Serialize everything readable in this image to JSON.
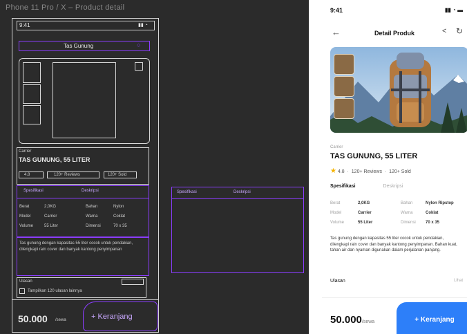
{
  "canvas": {
    "frame_title": "Phone 11 Pro / X – Product detail",
    "wireframe": {
      "status_time": "9:41",
      "search_text": "Tas Gunung",
      "info_tag": "Carrier",
      "product_title": "TAS GUNUNG, 55 LITER",
      "chips": [
        "4.8",
        "120+ Reviews",
        "120+ Sold"
      ],
      "table_headers": [
        "Spesifikasi",
        "Deskripsi"
      ],
      "side_headers": [
        "Spesifikasi",
        "Deskripsi"
      ],
      "table_rows": [
        [
          "Berat",
          "2,0KG",
          "Bahan",
          "Nylon"
        ],
        [
          "Model",
          "Carrier",
          "Warna",
          "Coklat"
        ],
        [
          "Volume",
          "55 Liter",
          "Dimensi",
          "70 x 35"
        ]
      ],
      "description": "Tas gunung dengan kapasitas 55 liter cocok untuk pendakian, dilengkapi rain cover dan banyak kantong penyimpanan",
      "reviews_label": "Ulasan",
      "reviews_item": "Tampilkan 120 ulasan lainnya",
      "price": "50.000",
      "price_unit": "/sewa",
      "buy_label": "+ Keranjang"
    }
  },
  "mock": {
    "status_time": "9:41",
    "nav_title": "Detail Produk",
    "back_icon": "arrow-left-icon",
    "share_icon": "share-icon",
    "hero_alt": "Carrier backpack with mountain landscape",
    "category": "Carrier",
    "product_title": "TAS GUNUNG, 55 LITER",
    "rating": "4.8",
    "reviews_count": "120+ Reviews",
    "sold_count": "120+ Sold",
    "tabs": [
      "Spesifikasi",
      "Deskripsi"
    ],
    "specs": [
      {
        "k": "Berat",
        "v": "2,0KG",
        "k2": "Bahan",
        "v2": "Nylon Ripstop"
      },
      {
        "k": "Model",
        "v": "Carrier",
        "k2": "Warna",
        "v2": "Coklat"
      },
      {
        "k": "Volume",
        "v": "55 Liter",
        "k2": "Dimensi",
        "v2": "70 x 35"
      }
    ],
    "description": "Tas gunung dengan kapasitas 55 liter cocok untuk pendakian, dilengkapi rain cover dan banyak kantong penyimpanan. Bahan kuat, tahan air dan nyaman digunakan dalam perjalanan panjang.",
    "reviews_label": "Ulasan",
    "reviews_link": "Lihat",
    "price": "50.000",
    "price_unit": "/sewa",
    "buy_label": "+ Keranjang",
    "accent": "#2d7ff9"
  }
}
